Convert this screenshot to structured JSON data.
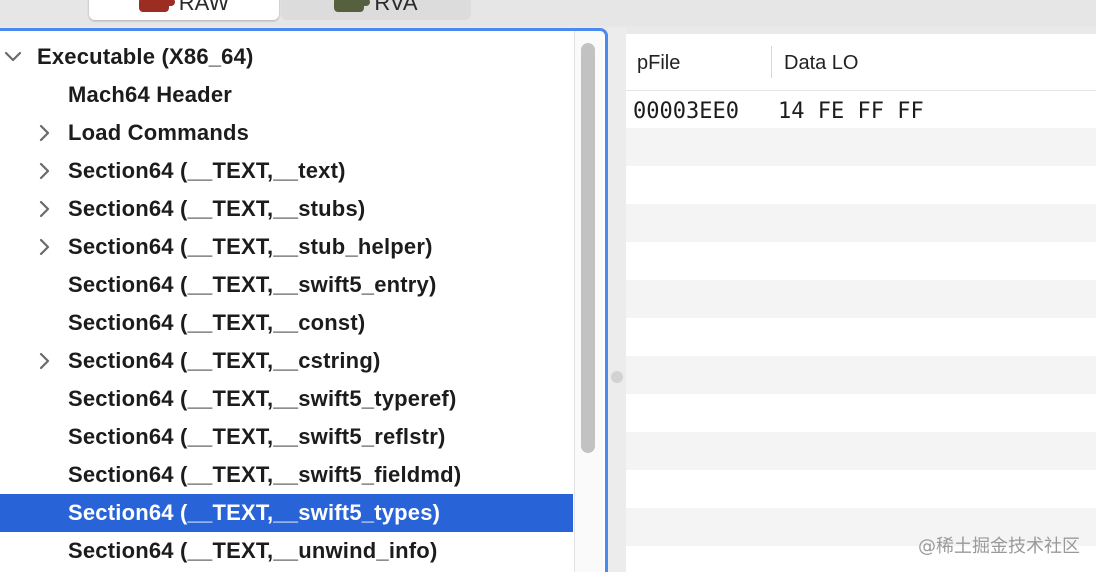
{
  "tabs": [
    {
      "label": "RAW",
      "icon": "raw-icon",
      "active": true
    },
    {
      "label": "RVA",
      "icon": "rva-icon",
      "active": false
    }
  ],
  "tree": {
    "items": [
      {
        "label": "Executable  (X86_64)",
        "expandable": true,
        "expanded": true,
        "depth": 0,
        "selected": false
      },
      {
        "label": "Mach64 Header",
        "expandable": false,
        "expanded": false,
        "depth": 1,
        "selected": false
      },
      {
        "label": "Load Commands",
        "expandable": true,
        "expanded": false,
        "depth": 1,
        "selected": false
      },
      {
        "label": "Section64 (__TEXT,__text)",
        "expandable": true,
        "expanded": false,
        "depth": 1,
        "selected": false
      },
      {
        "label": "Section64 (__TEXT,__stubs)",
        "expandable": true,
        "expanded": false,
        "depth": 1,
        "selected": false
      },
      {
        "label": "Section64 (__TEXT,__stub_helper)",
        "expandable": true,
        "expanded": false,
        "depth": 1,
        "selected": false
      },
      {
        "label": "Section64 (__TEXT,__swift5_entry)",
        "expandable": false,
        "expanded": false,
        "depth": 1,
        "selected": false
      },
      {
        "label": "Section64 (__TEXT,__const)",
        "expandable": false,
        "expanded": false,
        "depth": 1,
        "selected": false
      },
      {
        "label": "Section64 (__TEXT,__cstring)",
        "expandable": true,
        "expanded": false,
        "depth": 1,
        "selected": false
      },
      {
        "label": "Section64 (__TEXT,__swift5_typeref)",
        "expandable": false,
        "expanded": false,
        "depth": 1,
        "selected": false
      },
      {
        "label": "Section64 (__TEXT,__swift5_reflstr)",
        "expandable": false,
        "expanded": false,
        "depth": 1,
        "selected": false
      },
      {
        "label": "Section64 (__TEXT,__swift5_fieldmd)",
        "expandable": false,
        "expanded": false,
        "depth": 1,
        "selected": false
      },
      {
        "label": "Section64 (__TEXT,__swift5_types)",
        "expandable": false,
        "expanded": false,
        "depth": 1,
        "selected": true
      },
      {
        "label": "Section64 (__TEXT,__unwind_info)",
        "expandable": false,
        "expanded": false,
        "depth": 1,
        "selected": false
      }
    ]
  },
  "hex_table": {
    "columns": [
      "pFile",
      "Data LO"
    ],
    "rows": [
      {
        "pfile": "00003EE0",
        "data": "14 FE FF FF"
      }
    ]
  },
  "watermark": "@稀土掘金技术社区",
  "colors": {
    "selection": "#2864d8",
    "focus_ring": "#4a8af0"
  }
}
